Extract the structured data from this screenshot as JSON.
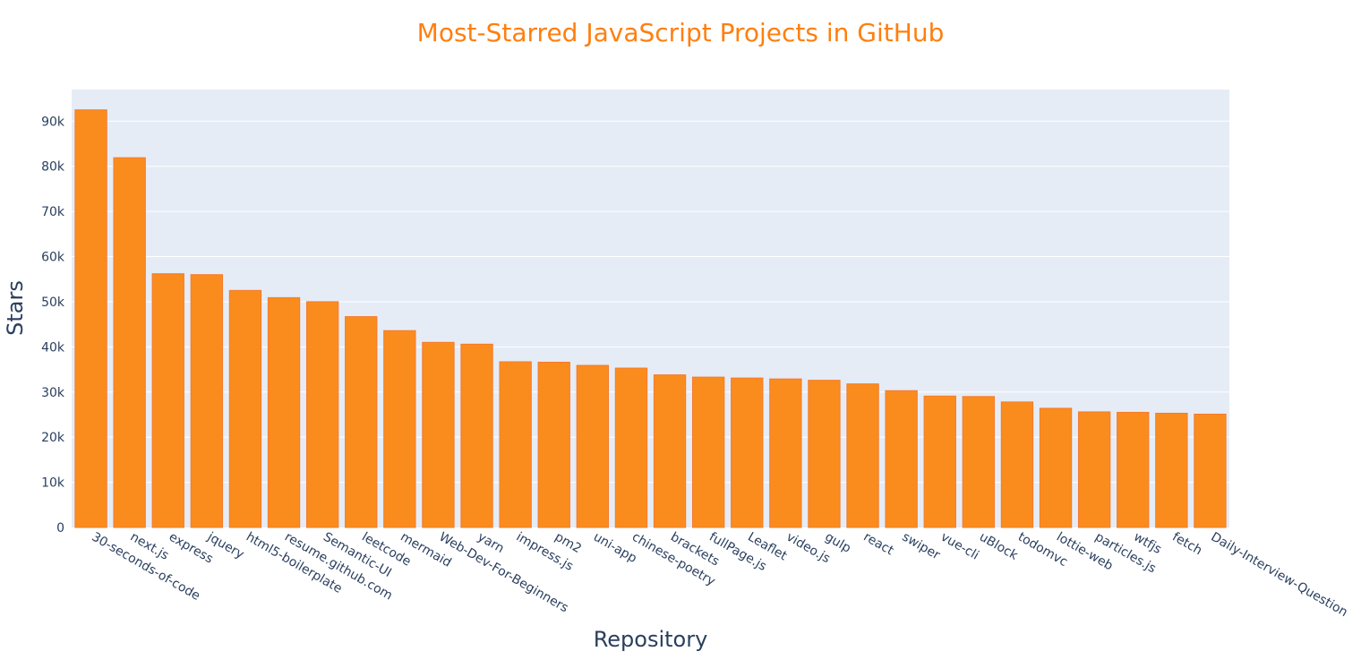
{
  "chart_data": {
    "type": "bar",
    "title": "Most-Starred JavaScript Projects in GitHub",
    "xlabel": "Repository",
    "ylabel": "Stars",
    "categories": [
      "30-seconds-of-code",
      "next.js",
      "express",
      "jquery",
      "html5-boilerplate",
      "resume.github.com",
      "Semantic-UI",
      "leetcode",
      "mermaid",
      "Web-Dev-For-Beginners",
      "yarn",
      "impress.js",
      "pm2",
      "uni-app",
      "chinese-poetry",
      "brackets",
      "fullPage.js",
      "Leaflet",
      "video.js",
      "gulp",
      "react",
      "swiper",
      "vue-cli",
      "uBlock",
      "todomvc",
      "lottie-web",
      "particles.js",
      "wtfjs",
      "fetch",
      "Daily-Interview-Question"
    ],
    "values": [
      92500,
      81900,
      56200,
      56000,
      52500,
      50900,
      50000,
      46700,
      43600,
      41000,
      40600,
      36700,
      36600,
      35900,
      35300,
      33800,
      33300,
      33100,
      32900,
      32600,
      31800,
      30300,
      29100,
      29000,
      27800,
      26400,
      25600,
      25500,
      25300,
      25100
    ],
    "ylim": [
      0,
      97000
    ],
    "yticks": [
      0,
      10000,
      20000,
      30000,
      40000,
      50000,
      60000,
      70000,
      80000,
      90000
    ],
    "ytick_labels": [
      "0",
      "10k",
      "20k",
      "30k",
      "40k",
      "50k",
      "60k",
      "70k",
      "80k",
      "90k"
    ],
    "grid": true,
    "colors": {
      "bar_fill": "#fa8c1e",
      "bar_stroke": "#f57a2c",
      "plot_bg": "#e5ecf6",
      "grid": "#ffffff",
      "title": "#ff7f0e",
      "axis_text": "#2a3f5f"
    }
  }
}
